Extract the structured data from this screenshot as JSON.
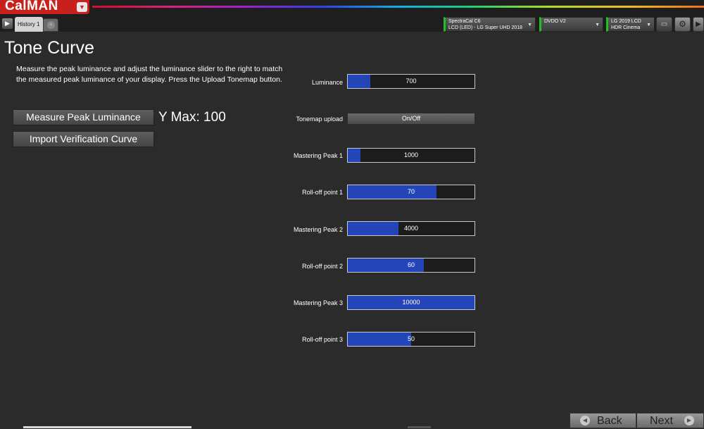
{
  "app": {
    "logo": "CalMAN",
    "logo_menu_icon": "dropdown-arrow-icon"
  },
  "tabs": [
    {
      "label": "History 1"
    }
  ],
  "devices": [
    {
      "line1": "SpectraCal C6",
      "line2": "LCD (LED) - LG Super UHD 2018"
    },
    {
      "line1": "DVDO V2",
      "line2": ""
    },
    {
      "line1": "LG 2019 LCD",
      "line2": "HDR Cinema"
    }
  ],
  "toolbar": {
    "display_icon": "monitor-icon",
    "settings_icon": "gear-icon",
    "collapse_icon": "chevron-right-icon"
  },
  "page": {
    "title": "Tone Curve",
    "description": "Measure the peak luminance and adjust the luminance slider to the right to match the measured peak luminance of your display. Press the Upload Tonemap button.",
    "measure_button": "Measure Peak Luminance",
    "import_button": "Import Verification Curve",
    "ymax": "Y Max: 100"
  },
  "controls": {
    "luminance": {
      "label": "Luminance",
      "value": "700",
      "fraction": 0.175
    },
    "tonemap": {
      "label": "Tonemap upload",
      "button": "On/Off"
    },
    "mastering_peak_1": {
      "label": "Mastering Peak 1",
      "value": "1000",
      "fraction": 0.1
    },
    "rolloff_1": {
      "label": "Roll-off point 1",
      "value": "70",
      "fraction": 0.7
    },
    "mastering_peak_2": {
      "label": "Mastering Peak 2",
      "value": "4000",
      "fraction": 0.4
    },
    "rolloff_2": {
      "label": "Roll-off point 2",
      "value": "60",
      "fraction": 0.6
    },
    "mastering_peak_3": {
      "label": "Mastering Peak 3",
      "value": "10000",
      "fraction": 1.0
    },
    "rolloff_3": {
      "label": "Roll-off point 3",
      "value": "50",
      "fraction": 0.5
    }
  },
  "footer": {
    "back": "Back",
    "next": "Next"
  },
  "colors": {
    "accent_blue": "#2445b8",
    "brand_red": "#c8211d",
    "status_green": "#22c022"
  }
}
